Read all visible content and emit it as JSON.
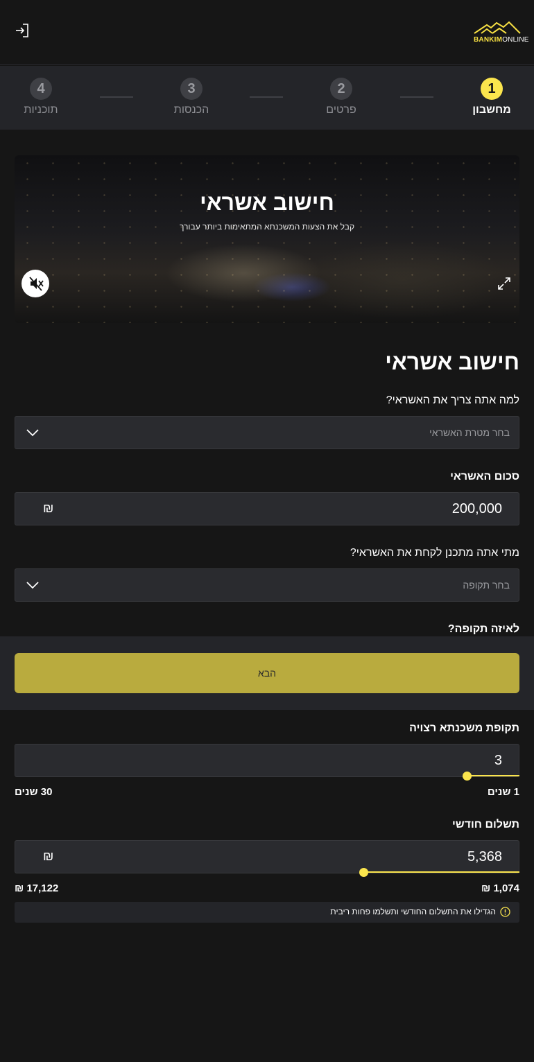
{
  "header": {
    "logo_text_bold": "BANKIM",
    "logo_text_light": "ONLINE"
  },
  "stepper": [
    {
      "number": "1",
      "label": "מחשבון",
      "active": true
    },
    {
      "number": "2",
      "label": "פרטים",
      "active": false
    },
    {
      "number": "3",
      "label": "הכנסות",
      "active": false
    },
    {
      "number": "4",
      "label": "תוכניות",
      "active": false
    }
  ],
  "video": {
    "title": "חישוב אשראי",
    "subtitle": "קבל את הצעות המשכנתא המתאימות ביותר עבורך",
    "mute_icon": "speaker-muted-icon",
    "fullscreen_icon": "expand-icon"
  },
  "form": {
    "title": "חישוב אשראי",
    "purpose": {
      "label": "למה אתה צריך את האשראי?",
      "placeholder": "בחר מטרת האשראי"
    },
    "amount": {
      "label": "סכום האשראי",
      "value": "200,000",
      "currency": "₪"
    },
    "timing": {
      "label": "מתי אתה מתכנן לקחת את האשראי?",
      "placeholder": "בחר תקופה"
    },
    "period_question": "לאיזה תקופה?",
    "next_button": "הבא",
    "mortgage_period": {
      "label": "תקופת משכנתא רצויה",
      "value": "3",
      "min_label": "1 שנים",
      "max_label": "30 שנים",
      "min": 1,
      "max": 30
    },
    "monthly_payment": {
      "label": "תשלום חודשי",
      "value": "5,368",
      "currency": "₪",
      "min_label": "1,074 ₪",
      "max_label": "17,122 ₪",
      "min": 1074,
      "max": 17122
    },
    "hint": "הגדילו את התשלום החודשי ותשלמו פחות ריבית"
  },
  "colors": {
    "accent": "#fbe54d",
    "button": "#b9ab3e",
    "background": "#161616",
    "surface": "#242529"
  }
}
